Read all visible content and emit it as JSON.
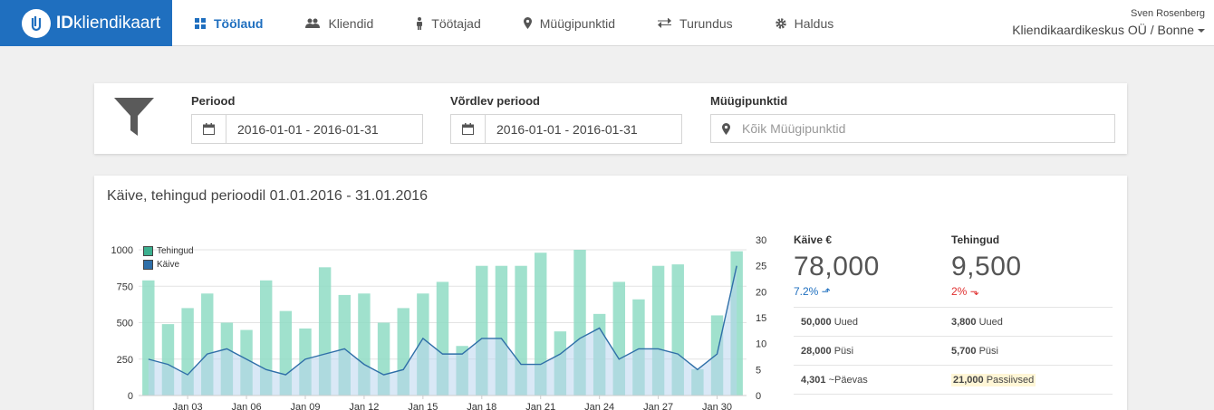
{
  "brand": {
    "bold": "ID",
    "rest": "kliendikaart"
  },
  "nav": [
    {
      "label": "Töölaud",
      "icon": "dashboard-icon",
      "active": true
    },
    {
      "label": "Kliendid",
      "icon": "users-icon",
      "active": false
    },
    {
      "label": "Töötajad",
      "icon": "person-icon",
      "active": false
    },
    {
      "label": "Müügipunktid",
      "icon": "map-marker-icon",
      "active": false
    },
    {
      "label": "Turundus",
      "icon": "exchange-icon",
      "active": false
    },
    {
      "label": "Haldus",
      "icon": "gear-icon",
      "active": false
    }
  ],
  "user": {
    "name": "Sven Rosenberg",
    "org": "Kliendikaardikeskus OÜ / Bonne"
  },
  "filter": {
    "period_label": "Periood",
    "period_value": "2016-01-01 - 2016-01-31",
    "compare_label": "Võrdlev periood",
    "compare_value": "2016-01-01 - 2016-01-31",
    "pos_label": "Müügipunktid",
    "pos_placeholder": "Kõik Müügipunktid"
  },
  "chart_panel": {
    "title": "Käive, tehingud perioodil 01.01.2016 - 31.01.2016"
  },
  "colors": {
    "primary": "#1f6fbf",
    "bar": "#8fdcc4",
    "line": "#2f6fa8",
    "area": "#b9d6ef"
  },
  "chart_data": {
    "type": "bar",
    "legend": [
      "Tehingud",
      "Käive"
    ],
    "x_tick_labels": [
      "Jan 03",
      "Jan 06",
      "Jan 09",
      "Jan 12",
      "Jan 15",
      "Jan 18",
      "Jan 21",
      "Jan 24",
      "Jan 27",
      "Jan 30"
    ],
    "x": [
      1,
      2,
      3,
      4,
      5,
      6,
      7,
      8,
      9,
      10,
      11,
      12,
      13,
      14,
      15,
      16,
      17,
      18,
      19,
      20,
      21,
      22,
      23,
      24,
      25,
      26,
      27,
      28,
      29,
      30,
      31
    ],
    "series": [
      {
        "name": "Tehingud",
        "axis": "left",
        "type": "bar",
        "values": [
          790,
          490,
          600,
          700,
          500,
          450,
          790,
          580,
          460,
          880,
          690,
          700,
          500,
          600,
          700,
          780,
          340,
          890,
          890,
          890,
          980,
          440,
          1000,
          560,
          780,
          660,
          890,
          900,
          180,
          550,
          990
        ]
      },
      {
        "name": "Käive",
        "axis": "right",
        "type": "area",
        "values": [
          7,
          6,
          4,
          8,
          9,
          7,
          5,
          4,
          7,
          8,
          9,
          6,
          4,
          5,
          11,
          8,
          8,
          11,
          11,
          6,
          6,
          8,
          11,
          13,
          7,
          9,
          9,
          8,
          5,
          8,
          25
        ]
      }
    ],
    "y_left_ticks": [
      0,
      250,
      500,
      750,
      1000
    ],
    "y_right_ticks": [
      0,
      5,
      10,
      15,
      20,
      25,
      30
    ],
    "ylim_left": [
      0,
      1000
    ],
    "ylim_right": [
      0,
      30
    ]
  },
  "stats": {
    "revenue_label": "Käive €",
    "revenue_value": "78,000",
    "revenue_change": "7.2%",
    "tx_label": "Tehingud",
    "tx_value": "9,500",
    "tx_change": "2%",
    "rows": [
      {
        "lv": "50,000",
        "lt": "Uued",
        "rv": "3,800",
        "rt": "Uued"
      },
      {
        "lv": "28,000",
        "lt": "Püsi",
        "rv": "5,700",
        "rt": "Püsi"
      },
      {
        "lv": "4,301",
        "lt": "~Päevas",
        "rv": "21,000",
        "rt": "Passiivsed"
      }
    ]
  }
}
